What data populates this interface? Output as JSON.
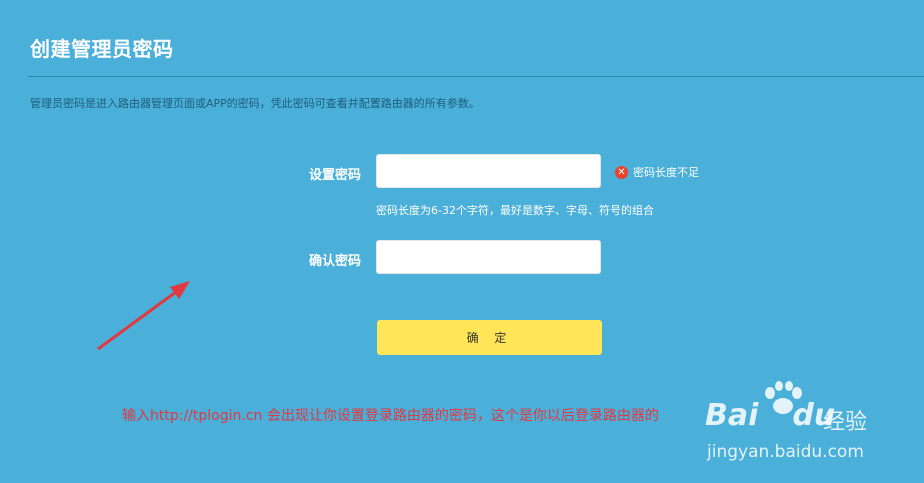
{
  "page": {
    "title": "创建管理员密码",
    "description": "管理员密码是进入路由器管理页面或APP的密码，凭此密码可查看并配置路由器的所有参数。"
  },
  "form": {
    "password_label": "设置密码",
    "password_value": "",
    "error_text": "密码长度不足",
    "error_icon": "close-icon",
    "hint_text": "密码长度为6-32个字符，最好是数字、字母、符号的组合",
    "confirm_label": "确认密码",
    "confirm_value": "",
    "submit_label": "确 定"
  },
  "annotation": {
    "text": "输入http://tplogin.cn 会出现让你设置登录路由器的密码，这个是你以后登录路由器的",
    "color": "#e2383f"
  },
  "watermark": {
    "brand": "Bai",
    "brand_suffix": "du",
    "product": "经验",
    "url": "jingyan.baidu.com"
  },
  "colors": {
    "background": "#4aafd9",
    "button": "#ffe557",
    "error": "#e8432a"
  }
}
